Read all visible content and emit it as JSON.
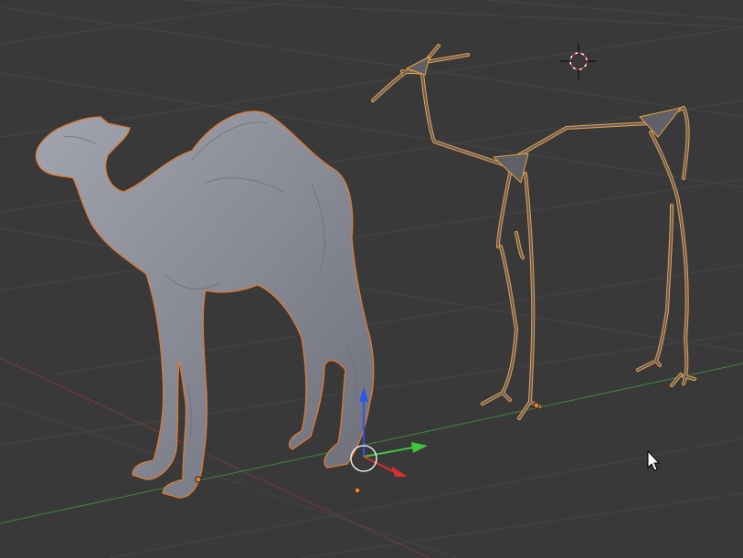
{
  "viewport": {
    "mode": "3D Viewport",
    "background": "#393939",
    "grid_color": "#454545",
    "x_axis_color": "#7a3a3a",
    "y_axis_color": "#3d8a3d"
  },
  "objects": [
    {
      "name": "camel-mesh",
      "kind": "mesh",
      "selected": true,
      "color": "#8a8c99",
      "outline": "#e07b2e"
    },
    {
      "name": "camel-skeleton",
      "kind": "curve-skeleton",
      "selected": true,
      "color": "#5f6068",
      "outline": "#f0a040"
    }
  ],
  "gizmo": {
    "x_color": "#d83030",
    "y_color": "#3ec43e",
    "z_color": "#2b56e6"
  },
  "cursor_3d": {
    "ring_color": "#d83030",
    "cross_color": "#111111"
  },
  "icons": {
    "cursor": "mouse-pointer-icon",
    "cursor_3d": "3d-cursor-icon",
    "origin": "object-origin-icon",
    "gizmo": "transform-gizmo-icon"
  }
}
